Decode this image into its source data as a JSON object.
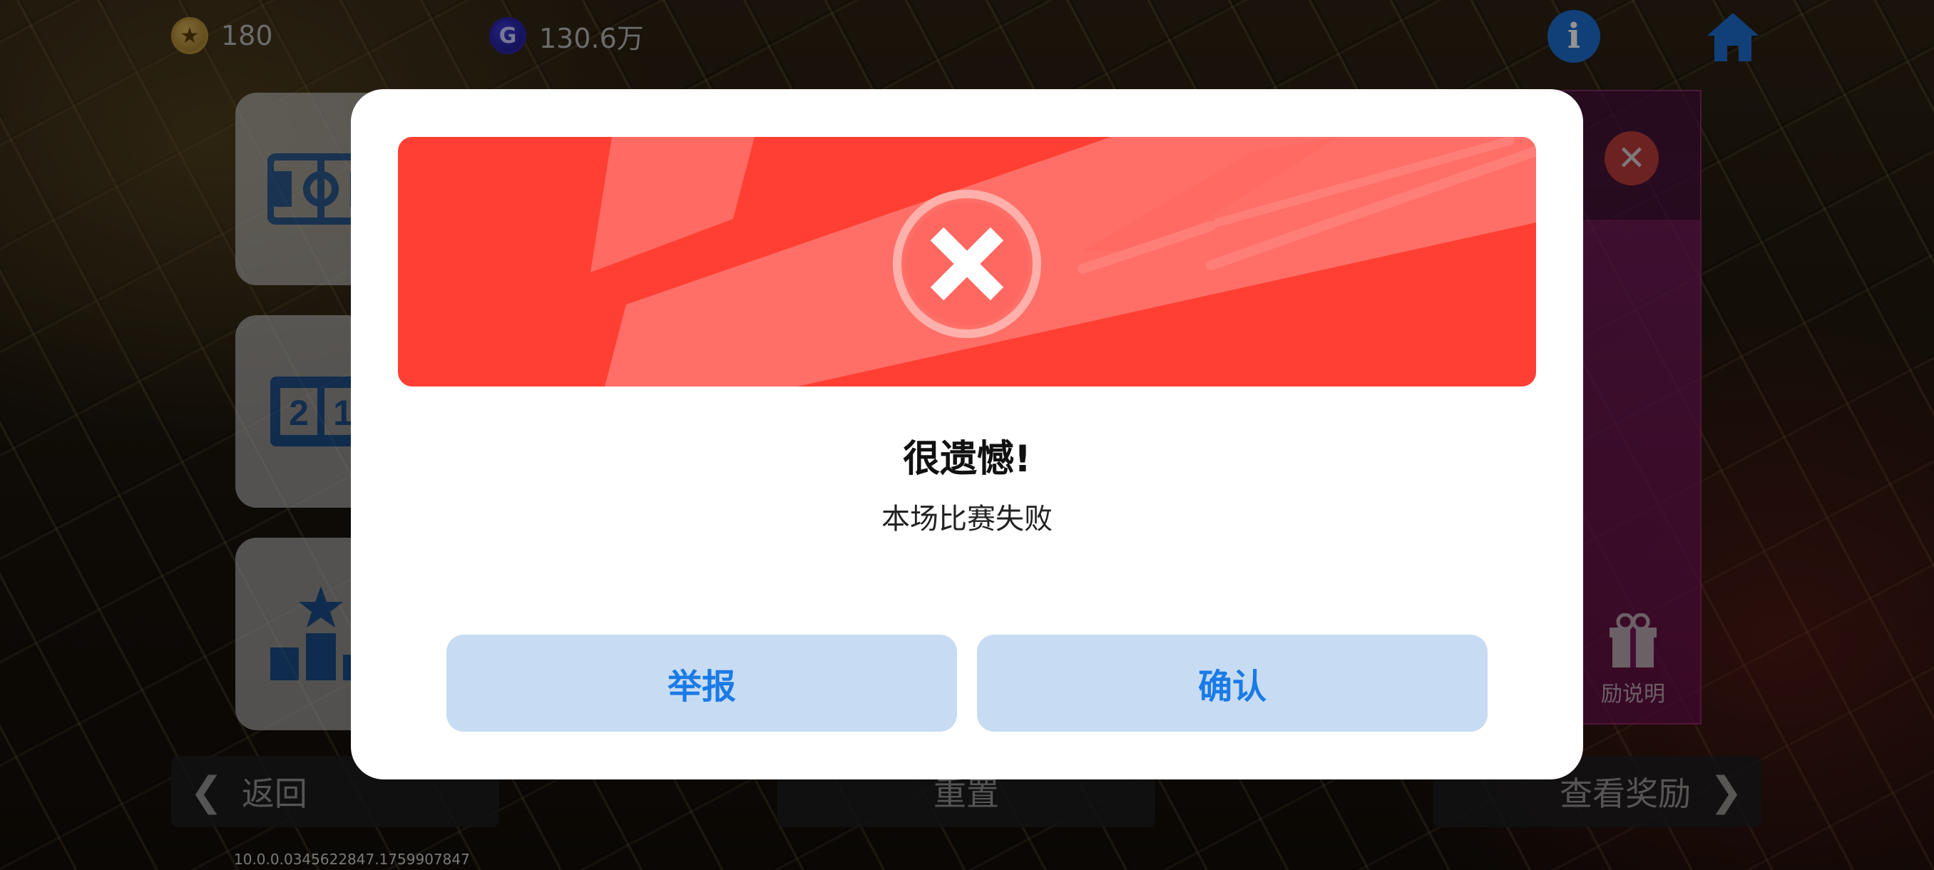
{
  "top_bar": {
    "stars": "180",
    "g_coins": "130.6万",
    "info_label": "i",
    "star_icon": "star-coin-icon",
    "g_icon": "g-coin-icon",
    "g_letter": "G",
    "home_icon": "home-icon"
  },
  "behind": {
    "card_icons": [
      "scoreboard-icon",
      "score-21-icon",
      "leaderboard-icon"
    ],
    "card_text": "2 1",
    "gift_label": "励说明",
    "back_label": "返回",
    "reset_label": "重置",
    "view_rewards_label": "查看奖励",
    "version": "10.0.0.0345622847.1759907847"
  },
  "dialog": {
    "title": "很遗憾!",
    "message": "本场比赛失败",
    "report_label": "举报",
    "confirm_label": "确认",
    "banner_icon": "fail-x-icon"
  },
  "colors": {
    "banner": "#ff3f33",
    "button_bg": "#c7dcf2",
    "button_text": "#1a7be6"
  }
}
